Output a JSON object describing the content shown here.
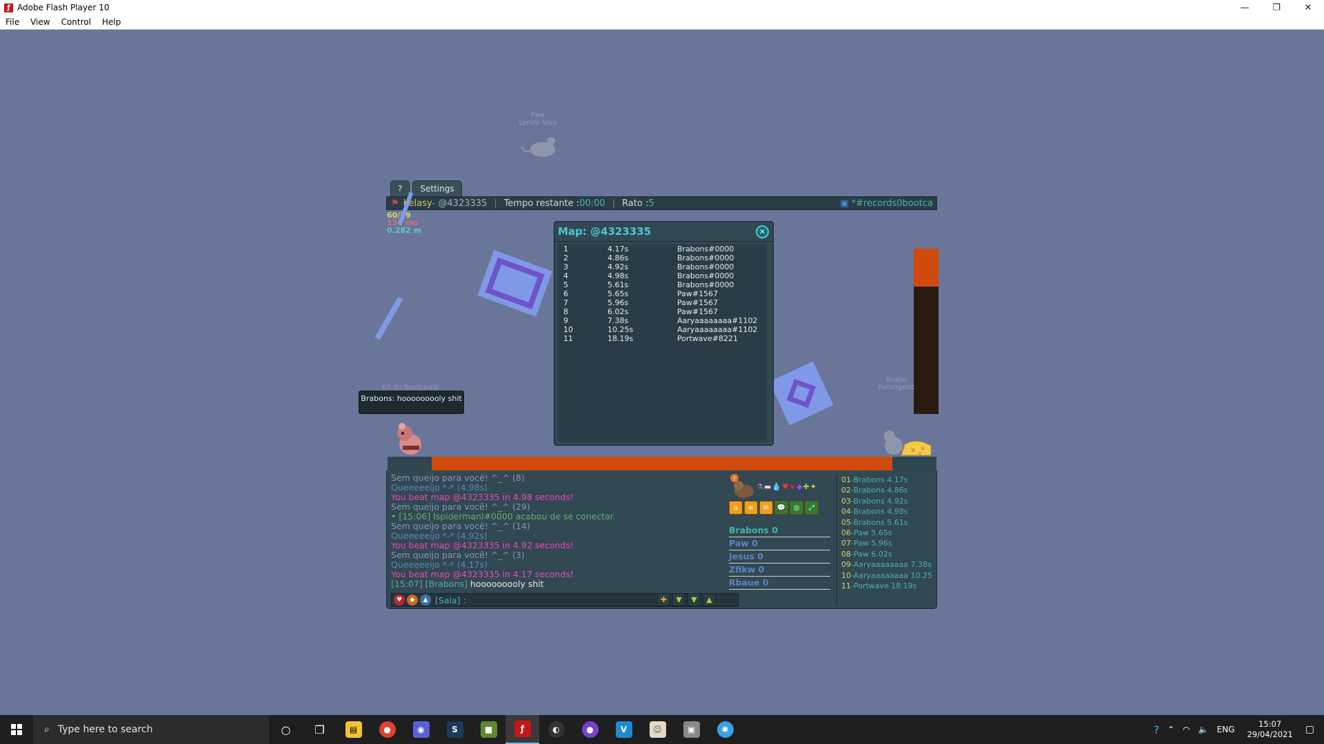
{
  "window": {
    "title": "Adobe Flash Player 10",
    "minimize": "—",
    "restore": "❐",
    "close": "✕"
  },
  "menu": {
    "file": "File",
    "view": "View",
    "control": "Control",
    "help": "Help"
  },
  "tabs": {
    "help": "?",
    "settings": "Settings"
  },
  "hud": {
    "player": "Kelasy",
    "map_code": " - @4323335",
    "time_label": "Tempo restante : ",
    "time_value": "00:00",
    "mice_label": "Rato : ",
    "mice_value": "5",
    "room": "*#records0bootca"
  },
  "stats": {
    "fps": "60/59",
    "mem": "136 mo",
    "dist": "0.282 m"
  },
  "ghost_labels": {
    "top": "Paw",
    "top_sub": "Lenda Viva",
    "left": "Kit do Bootcamp",
    "right": "Brabo",
    "right_sub": "Poltergeist"
  },
  "bubble": {
    "text": "Brabons: hooooooooly shit"
  },
  "map_dialog": {
    "title": "Map: @4323335",
    "close": "✕",
    "rows": [
      {
        "n": "1",
        "t": "4.17s",
        "p": "Brabons#0000"
      },
      {
        "n": "2",
        "t": "4.86s",
        "p": "Brabons#0000"
      },
      {
        "n": "3",
        "t": "4.92s",
        "p": "Brabons#0000"
      },
      {
        "n": "4",
        "t": "4.98s",
        "p": "Brabons#0000"
      },
      {
        "n": "5",
        "t": "5.61s",
        "p": "Brabons#0000"
      },
      {
        "n": "6",
        "t": "5.65s",
        "p": "Paw#1567"
      },
      {
        "n": "7",
        "t": "5.96s",
        "p": "Paw#1567"
      },
      {
        "n": "8",
        "t": "6.02s",
        "p": "Paw#1567"
      },
      {
        "n": "9",
        "t": "7.38s",
        "p": "Aaryaaaaaaaa#1102"
      },
      {
        "n": "10",
        "t": "10.25s",
        "p": "Aaryaaaaaaaa#1102"
      },
      {
        "n": "11",
        "t": "18.19s",
        "p": "Portwave#8221"
      }
    ]
  },
  "chat": [
    {
      "cls": "cg",
      "text": "Sem queijo para você! ^_^ (8)"
    },
    {
      "cls": "cb",
      "text": "Queeeeeijo *-* (4.98s)"
    },
    {
      "cls": "cp",
      "text": "You beat map @4323335 in 4.98 seconds!"
    },
    {
      "cls": "cg",
      "text": "Sem queijo para você! ^_^ (29)"
    },
    {
      "cls": "cgr",
      "text": "• [15:06] Ispidermanl#0000 acabou de se conectar."
    },
    {
      "cls": "cg",
      "text": "Sem queijo para você! ^_^ (14)"
    },
    {
      "cls": "cb",
      "text": "Queeeeeijo *-* (4.92s)"
    },
    {
      "cls": "cp",
      "text": "You beat map @4323335 in 4.92 seconds!"
    },
    {
      "cls": "cg",
      "text": "Sem queijo para você! ^_^ (3)"
    },
    {
      "cls": "cb",
      "text": "Queeeeeijo *-* (4.17s)"
    },
    {
      "cls": "cp",
      "text": "You beat map @4323335 in 4.17 seconds!"
    }
  ],
  "chat_last": {
    "prefix": "[15:07] [Brabons] ",
    "message": "hooooooooly shit"
  },
  "chat_input": {
    "placeholder": "[Sala] :"
  },
  "players": [
    {
      "name": "Brabons",
      "score": "0",
      "color": "#46b3b0"
    },
    {
      "name": "Paw",
      "score": "0",
      "color": "#5e85c4"
    },
    {
      "name": "Jesus",
      "score": "0",
      "color": "#5e85c4"
    },
    {
      "name": "Zfikw",
      "score": "0",
      "color": "#5e85c4"
    },
    {
      "name": "Rbaue",
      "score": "0",
      "color": "#5e85c4"
    }
  ],
  "ranking": [
    {
      "pos": "01",
      "text": "-Brabons 4.17s"
    },
    {
      "pos": "02",
      "text": "-Brabons 4.86s"
    },
    {
      "pos": "03",
      "text": "-Brabons 4.92s"
    },
    {
      "pos": "04",
      "text": "-Brabons 4.98s"
    },
    {
      "pos": "05",
      "text": "-Brabons 5.61s"
    },
    {
      "pos": "06",
      "text": "-Paw 5.65s"
    },
    {
      "pos": "07",
      "text": "-Paw 5.96s"
    },
    {
      "pos": "08",
      "text": "-Paw 6.02s"
    },
    {
      "pos": "09",
      "text": "-Aaryaaaaaaaa 7.38s"
    },
    {
      "pos": "10",
      "text": "-Aaryaaaaaaaa 10.25"
    },
    {
      "pos": "11",
      "text": "-Portwave 18.19s"
    }
  ],
  "taskbar": {
    "search_placeholder": "Type here to search",
    "lang": "ENG",
    "time": "15:07",
    "date": "29/04/2021"
  },
  "colors": {
    "accent": "#46b3b0",
    "lava": "#d14a0b",
    "panel": "#324852",
    "background": "#6a7699"
  }
}
